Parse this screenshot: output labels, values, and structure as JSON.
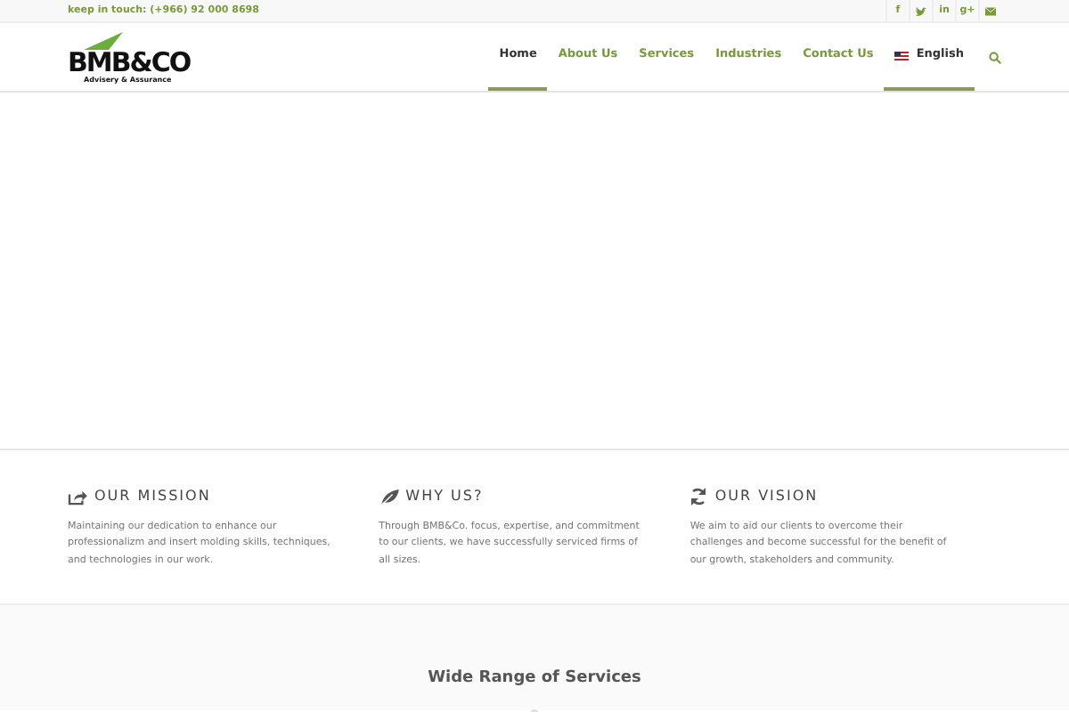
{
  "topbar": {
    "contact": "keep in touch: (+966) 92 000 8698",
    "social": [
      {
        "kind": "glyph",
        "text": "f"
      },
      {
        "kind": "bird"
      },
      {
        "kind": "glyph",
        "text": "in"
      },
      {
        "kind": "glyph",
        "text": "g+"
      },
      {
        "kind": "mail"
      }
    ]
  },
  "logo": {
    "name": "BMB&CO",
    "tagline": "Advisery & Assurance"
  },
  "nav": [
    {
      "label": "Home",
      "selected": true
    },
    {
      "label": "About Us",
      "selected": false
    },
    {
      "label": "Services",
      "selected": false
    },
    {
      "label": "Industries",
      "selected": false
    },
    {
      "label": "Contact Us",
      "selected": false
    },
    {
      "label": "English",
      "selected": true,
      "kind": "language"
    }
  ],
  "features": [
    {
      "kind": "share",
      "title": "OUR MISSION",
      "text": "Maintaining our dedication to enhance our professionalizm and insert molding skills, techniques, and technologies in our work."
    },
    {
      "kind": "leaf",
      "title": "WHY US?",
      "text": "Through BMB&Co. focus, expertise, and commitment to our clients, we have successfully serviced firms of all sizes."
    },
    {
      "kind": "refresh",
      "title": "OUR VISION",
      "text": "We aim to aid our clients to overcome their challenges and become successful for the benefit of our growth, stakeholders and community."
    }
  ],
  "services": {
    "title": "Wide Range of Services"
  }
}
